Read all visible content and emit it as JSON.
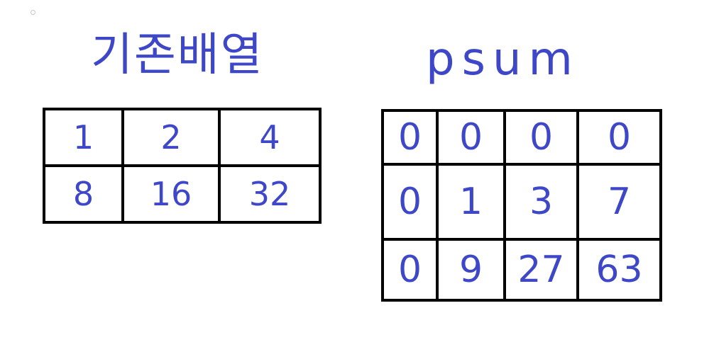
{
  "left": {
    "title": "기존배열",
    "rows": [
      [
        "1",
        "2",
        "4"
      ],
      [
        "8",
        "16",
        "32"
      ]
    ]
  },
  "right": {
    "title": "psum",
    "rows": [
      [
        "0",
        "0",
        "0",
        "0"
      ],
      [
        "0",
        "1",
        "3",
        "7"
      ],
      [
        "0",
        "9",
        "27",
        "63"
      ]
    ]
  },
  "colors": {
    "ink": "#3d47c8",
    "grid": "#000000",
    "background": "#ffffff"
  }
}
